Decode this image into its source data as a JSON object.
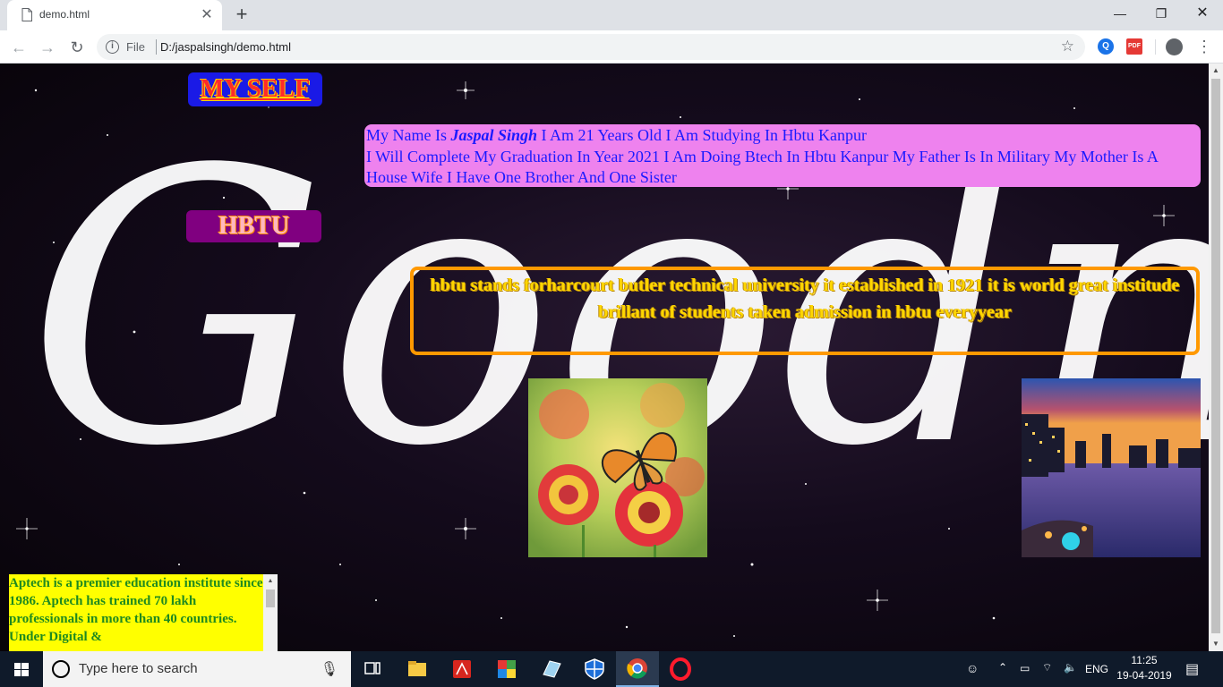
{
  "browser": {
    "tab_title": "demo.html",
    "omnibox_scheme_label": "File",
    "url": "D:/jaspalsingh/demo.html"
  },
  "page": {
    "myself_button": "MY SELF",
    "bio": {
      "line1_prefix": "My Name Is ",
      "name": "Jaspal Singh",
      "line1_suffix": " I Am 21 Years Old I Am Studying In Hbtu Kanpur",
      "line2": "I Will Complete My Graduation In Year 2021 I Am Doing Btech In Hbtu Kanpur My Father Is In Military My Mother Is A House Wife I Have One Brother And One Sister"
    },
    "hbtu_button": "HBTU",
    "info": {
      "line1": "hbtu stands forharcourt butler technical university it established in 1921 it is world great institude",
      "line2": "brillant of students taken admission in hbtu everyyear"
    },
    "images": [
      "butterfly-on-flowers",
      "city-waterfront-at-dusk"
    ],
    "marquee_text": "Aptech is a premier education institute since 1986. Aptech has trained 70 lakh professionals in more than 40 countries. Under Digital &"
  },
  "taskbar": {
    "search_placeholder": "Type here to search",
    "language": "ENG",
    "time": "11:25",
    "date": "19-04-2019"
  }
}
